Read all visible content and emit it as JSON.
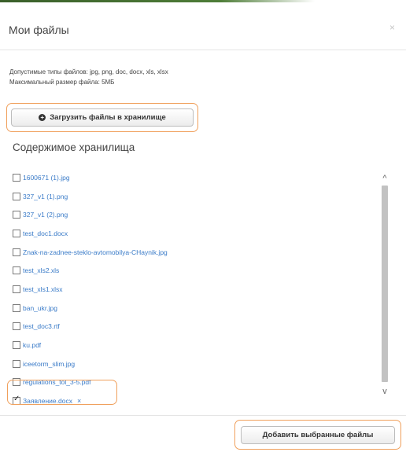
{
  "modal": {
    "title": "Мои файлы",
    "close_glyph": "×"
  },
  "info": {
    "allowed_types": "Допустимые типы файлов: jpg, png, doc, docx, xls, xlsx",
    "max_size": "Максимальный размер файла: 5МБ"
  },
  "upload": {
    "icon": "plus-circle-icon",
    "icon_glyph": "+",
    "label": "Загрузить файлы в хранилище"
  },
  "storage": {
    "heading": "Содержимое хранилища",
    "files": [
      {
        "name": "1600671 (1).jpg",
        "checked": false
      },
      {
        "name": "327_v1 (1).png",
        "checked": false
      },
      {
        "name": "327_v1 (2).png",
        "checked": false
      },
      {
        "name": "test_doc1.docx",
        "checked": false
      },
      {
        "name": "Znak-na-zadnee-steklo-avtomobilya-CHaynik.jpg",
        "checked": false
      },
      {
        "name": "test_xls2.xls",
        "checked": false
      },
      {
        "name": "test_xls1.xlsx",
        "checked": false
      },
      {
        "name": "ban_ukr.jpg",
        "checked": false
      },
      {
        "name": "test_doc3.rtf",
        "checked": false
      },
      {
        "name": "ku.pdf",
        "checked": false
      },
      {
        "name": "iceetorm_slim.jpg",
        "checked": false
      },
      {
        "name": "regulations_tol_3-5.pdf",
        "checked": false
      },
      {
        "name": "Заявление.docx",
        "checked": true,
        "remove_mark": "×"
      }
    ]
  },
  "scrollbar": {
    "up_glyph": "^",
    "down_glyph": "v"
  },
  "footer": {
    "add_label": "Добавить выбранные файлы"
  },
  "colors": {
    "link": "#3a7bc8",
    "highlight": "#f0a05c",
    "accent_bar": "#4e7d38"
  }
}
